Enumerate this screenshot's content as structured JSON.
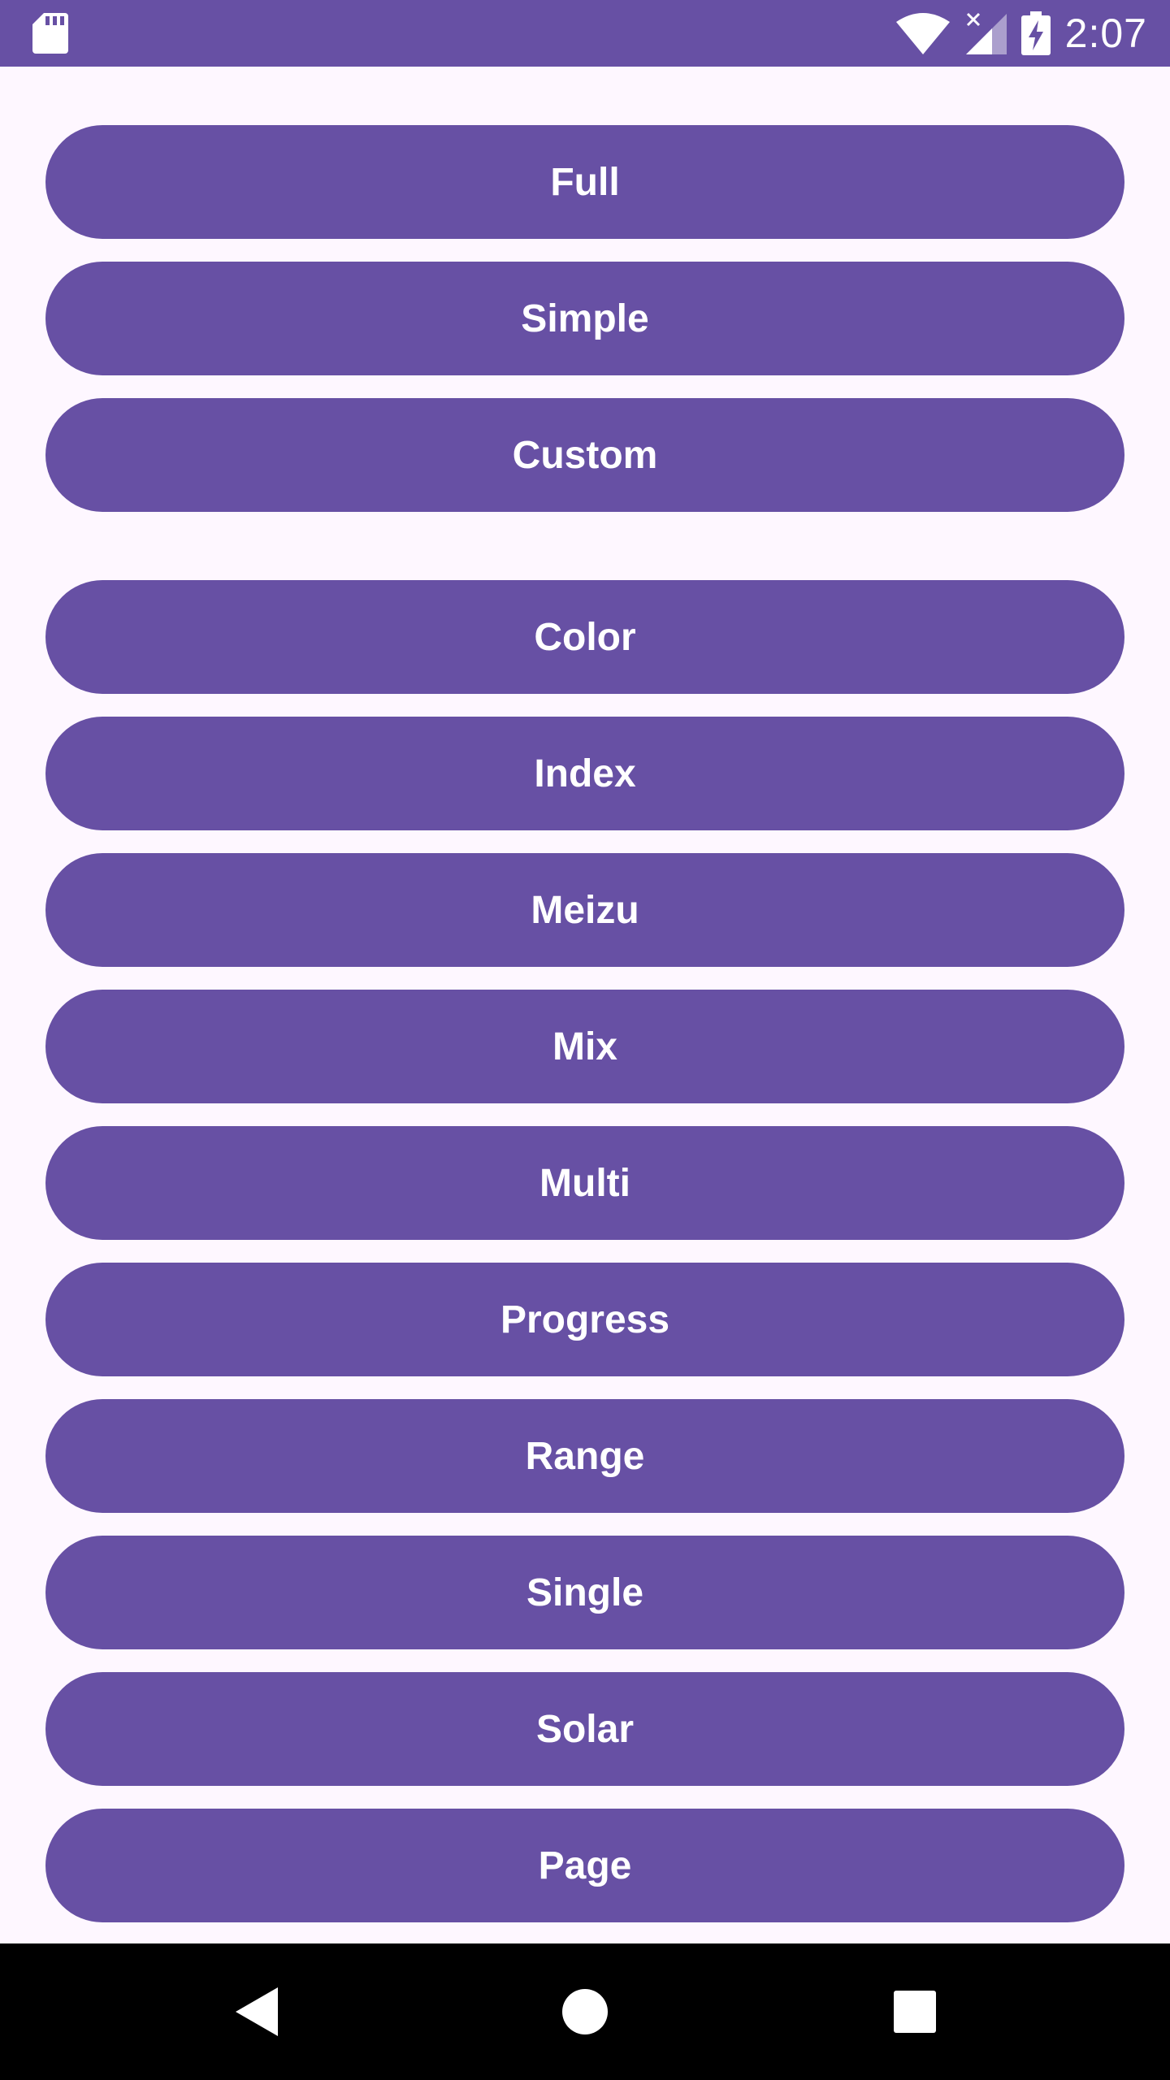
{
  "status_bar": {
    "time": "2:07",
    "icons": [
      "sd-card-icon",
      "wifi-icon",
      "signal-icon",
      "battery-charging-icon"
    ]
  },
  "buttons": [
    {
      "label": "Full"
    },
    {
      "label": "Simple"
    },
    {
      "label": "Custom"
    },
    {
      "label": "Color"
    },
    {
      "label": "Index"
    },
    {
      "label": "Meizu"
    },
    {
      "label": "Mix"
    },
    {
      "label": "Multi"
    },
    {
      "label": "Progress"
    },
    {
      "label": "Range"
    },
    {
      "label": "Single"
    },
    {
      "label": "Solar"
    },
    {
      "label": "Page"
    }
  ],
  "nav_bar": {
    "icons": [
      "back-icon",
      "home-icon",
      "recents-icon"
    ]
  },
  "colors": {
    "primary": "#6750A4",
    "background": "#FEF7FF",
    "nav_background": "#000000"
  }
}
